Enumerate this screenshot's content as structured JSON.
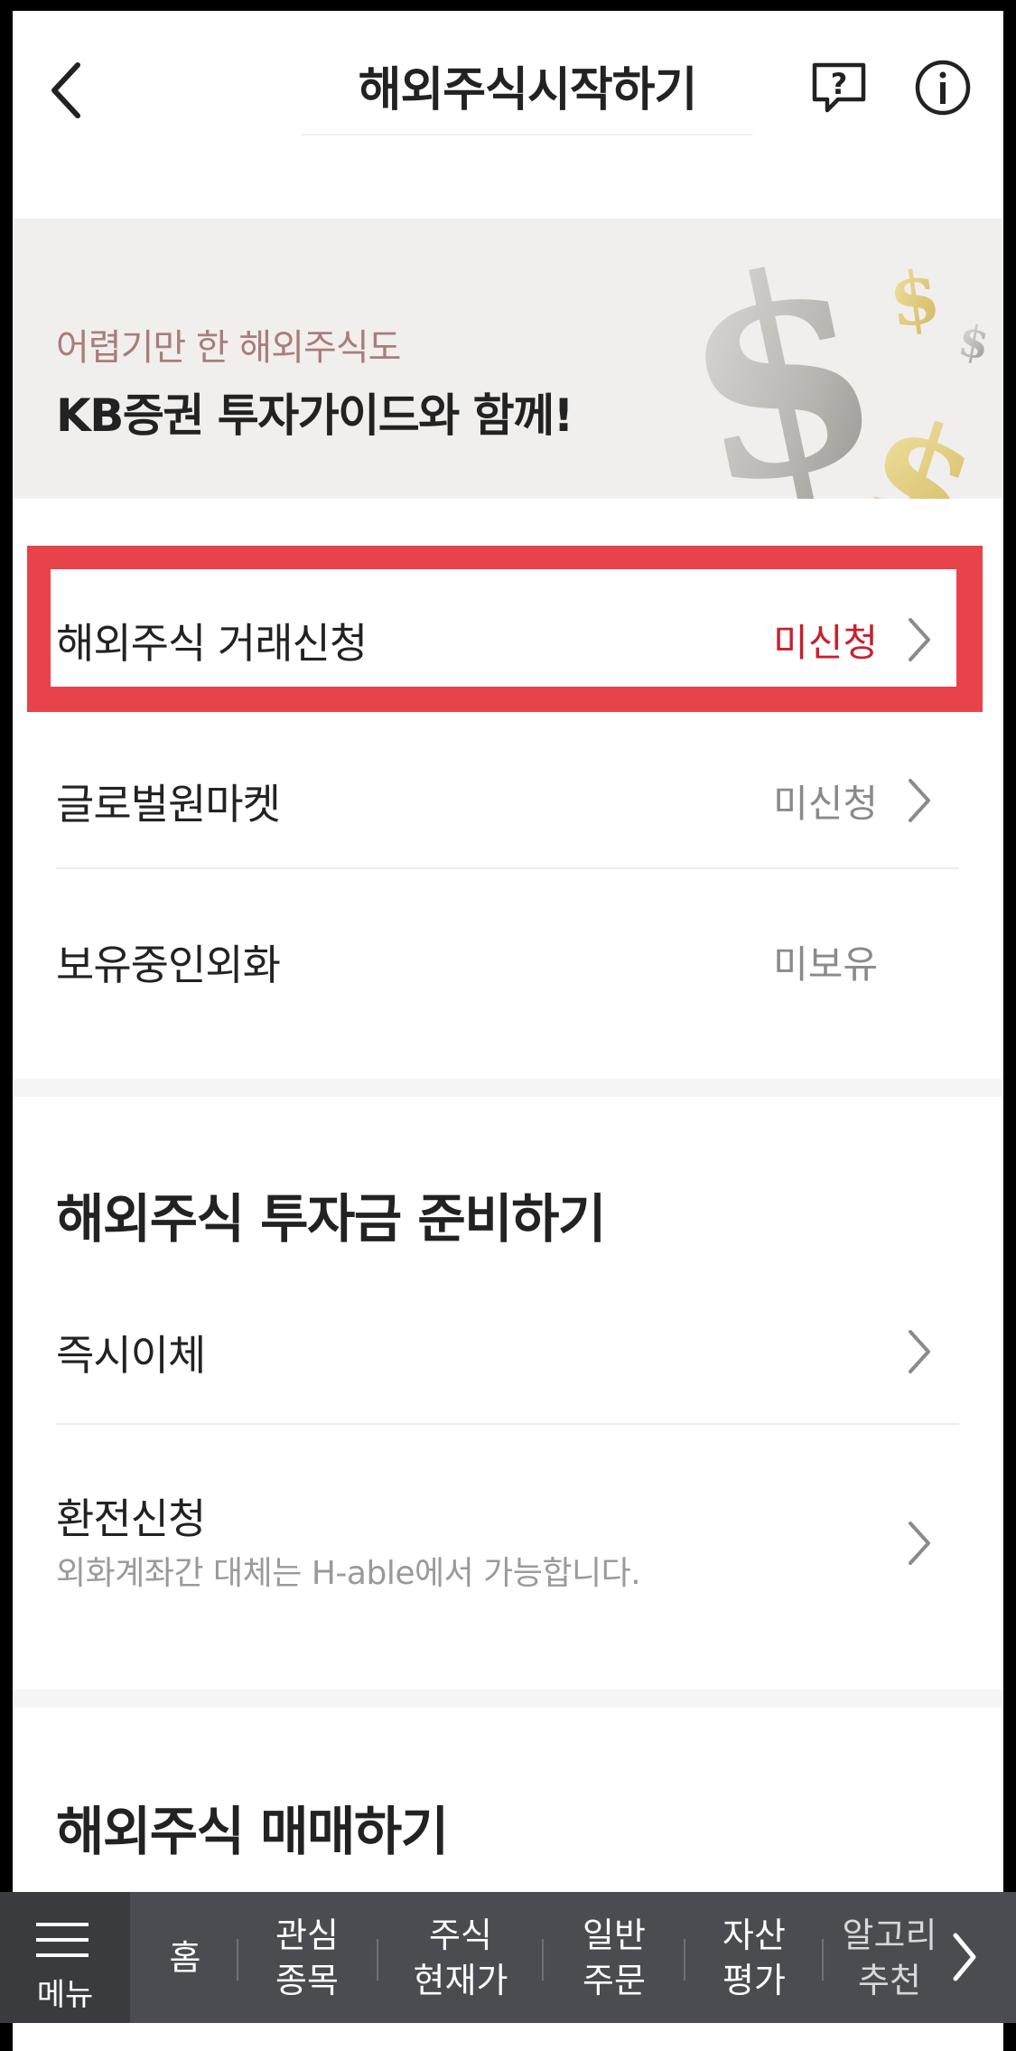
{
  "header": {
    "title": "해외주식시작하기",
    "back_icon": "chevron-left-icon",
    "help_icon": "question-chat-icon",
    "info_icon": "info-circle-icon"
  },
  "banner": {
    "subtitle": "어렵기만 한 해외주식도",
    "title": "KB증권 투자가이드와 함께!"
  },
  "status_rows": [
    {
      "label": "해외주식 거래신청",
      "status": "미신청",
      "highlighted": true
    },
    {
      "label": "글로벌원마켓",
      "status": "미신청"
    },
    {
      "label": "보유중인외화",
      "status": "미보유"
    }
  ],
  "prepare_section": {
    "title": "해외주식 투자금 준비하기",
    "items": [
      {
        "label": "즉시이체"
      },
      {
        "label": "환전신청",
        "sub": "외화계좌간 대체는 H-able에서 가능합니다."
      }
    ]
  },
  "trade_section": {
    "title": "해외주식 매매하기"
  },
  "bottom_nav": {
    "menu_label": "메뉴",
    "items": [
      {
        "line1": "홈",
        "line2": ""
      },
      {
        "line1": "관심",
        "line2": "종목"
      },
      {
        "line1": "주식",
        "line2": "현재가"
      },
      {
        "line1": "일반",
        "line2": "주문"
      },
      {
        "line1": "자산",
        "line2": "평가"
      },
      {
        "line1": "알고리",
        "line2": "추천"
      }
    ]
  },
  "colors": {
    "highlight_box": "#e8424b",
    "status_red": "#c8202e",
    "nav_bg": "#4a4c51"
  }
}
